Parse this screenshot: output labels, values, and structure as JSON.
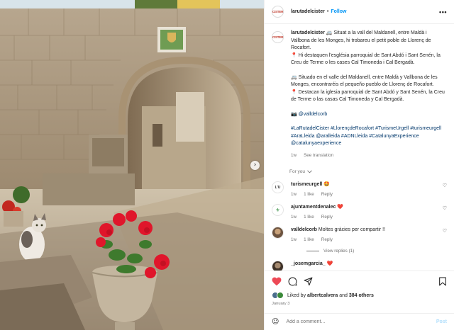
{
  "post": {
    "username": "larutadelcister",
    "follow_label": "Follow",
    "more_label": "•••",
    "next_label": "›",
    "caption_username": "larutadelcister",
    "caption_lines": [
      "🚐 Situat a la vall del Maldanell, entre Maldà i Vallbona de les Monges, hi trobareu el petit poble de Llorenç de Rocafort.",
      "📍 Hi destaquen l'església parroquial de Sant Abdó i Sant Senén, la Creu de Terme o les cases Cal Timoneda i Cal Bergadà.",
      "🚐 Situado en el valle del Maldanell, entre Maldà y Vallbona de les Monges, encontraréis el pequeño pueblo de Llorenç de Rocafort.",
      "📍 Destacan la iglesia parroquial de Sant Abdó y Sant Senén, la Creu de Terme o las casas Cal Timoneda y Cal Bergadà."
    ],
    "camera_line": "📷 @valldelcorb",
    "hashtags": "#LaRutadelCister #LlorençdeRocafort #TurismeUrgell #turismeurgell #AraLleida @aralleida #ADNLleida #CatalunyaExperience @catalunyaexperience",
    "caption_time": "1w",
    "see_translation": "See translation",
    "for_you": "For you",
    "logo_text": "CISTER"
  },
  "comments": [
    {
      "username": "turismeurgell",
      "text": "🤩",
      "time": "1w",
      "likes": "1 like",
      "reply": "Reply",
      "avatar_color": "#ffffff",
      "avatar_text": "L'U"
    },
    {
      "username": "ajuntamentdenalec",
      "text": "❤️",
      "time": "1w",
      "likes": "1 like",
      "reply": "Reply",
      "avatar_color": "#ffffff",
      "avatar_text": "⚜"
    },
    {
      "username": "valldelcorb",
      "text": "Moltes gràcies per compartir !!",
      "time": "1w",
      "likes": "1 like",
      "reply": "Reply",
      "avatar_color": "#8a6d4e",
      "avatar_text": ""
    },
    {
      "username": "_josemgarcia_",
      "text": "❤️",
      "time": "",
      "likes": "",
      "reply": "",
      "avatar_color": "#5c4a3a",
      "avatar_text": ""
    }
  ],
  "view_replies": "View replies (1)",
  "likes": {
    "prefix": "Liked by",
    "user": "albertcalvera",
    "connector": "and",
    "count": "384 others"
  },
  "date": "January 3",
  "add_comment": {
    "placeholder": "Add a comment...",
    "post_label": "Post"
  },
  "colors": {
    "follow": "#0095f6",
    "heart_red": "#ed4956",
    "muted": "#737373"
  }
}
